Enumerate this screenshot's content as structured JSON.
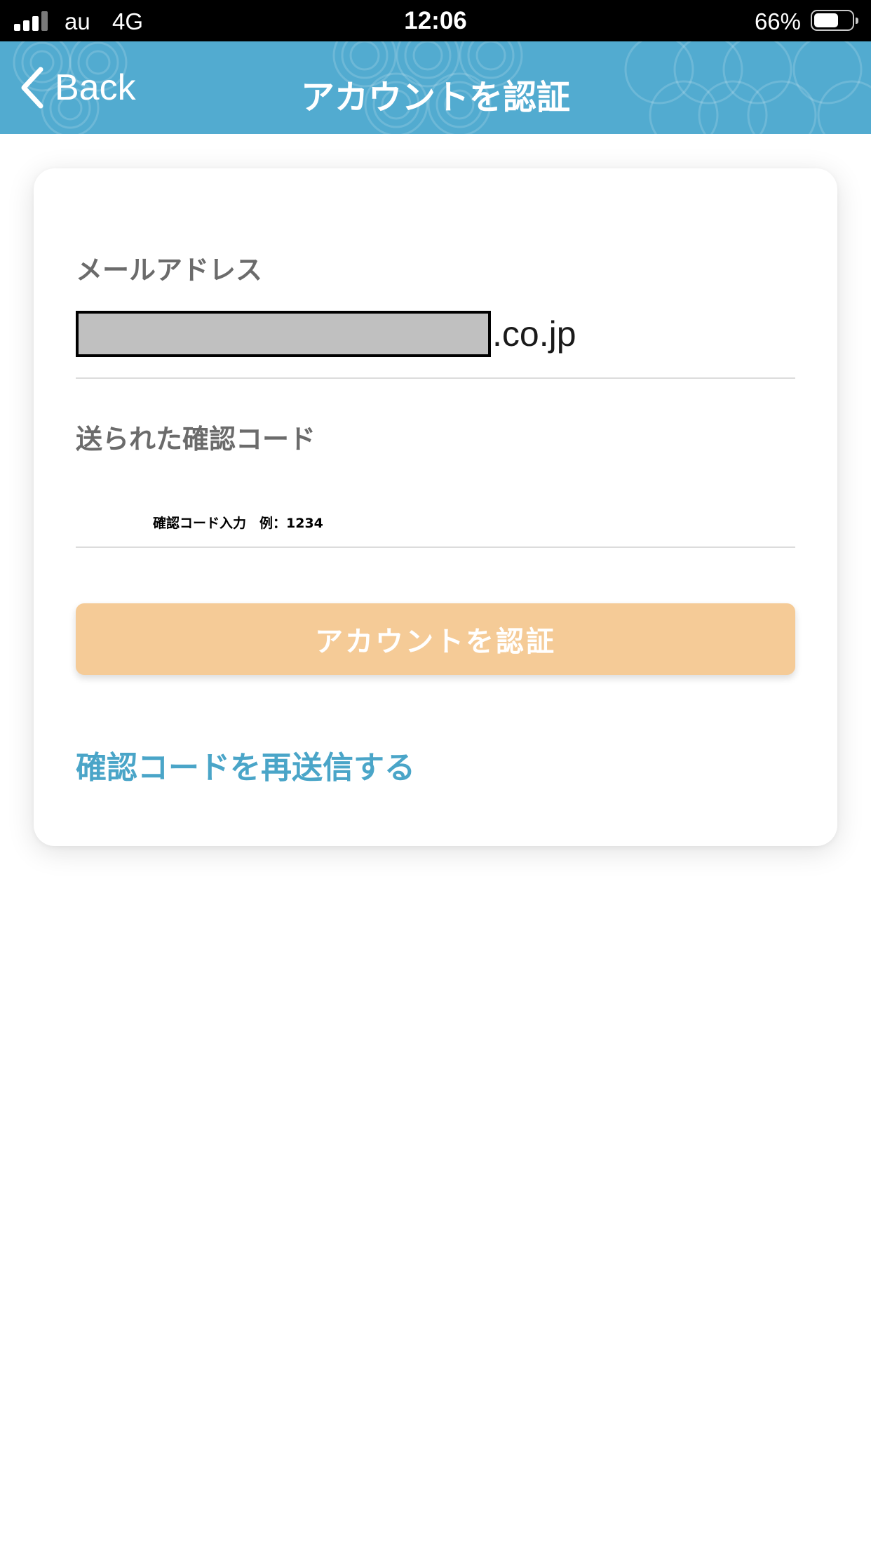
{
  "status_bar": {
    "carrier": "au",
    "network": "4G",
    "time": "12:06",
    "battery_percent": "66%",
    "battery_level": 0.66
  },
  "nav": {
    "back_label": "Back",
    "title": "アカウントを認証",
    "background_color": "#52abd0"
  },
  "form": {
    "email_label": "メールアドレス",
    "email_suffix": ".co.jp",
    "code_label": "送られた確認コード",
    "code_placeholder": "確認コード入力　例：1234",
    "code_value": "",
    "verify_button": "アカウントを認証",
    "resend_link": "確認コードを再送信する"
  },
  "colors": {
    "button": "#f5cb97",
    "link": "#4aa5c8",
    "label": "#6b6b6b"
  }
}
